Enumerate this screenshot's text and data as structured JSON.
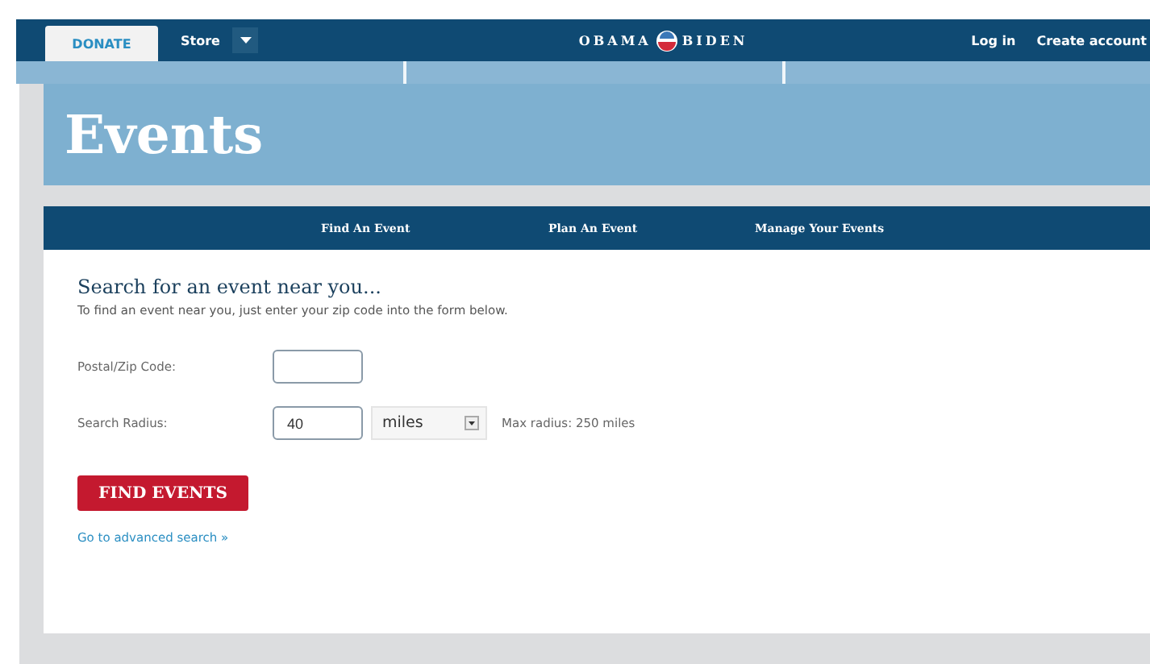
{
  "top_bar": {
    "donate": "DONATE",
    "store": "Store",
    "logo_left": "OBAMA",
    "logo_right": "BIDEN",
    "links": [
      "Log in",
      "Create account"
    ]
  },
  "banner": {
    "title": "Events"
  },
  "nav": [
    "Find An Event",
    "Plan An Event",
    "Manage Your Events"
  ],
  "search": {
    "heading": "Search for an event near you...",
    "intro": "To find an event near you, just enter your zip code into the form below.",
    "zip": {
      "label": "Postal/Zip Code:"
    },
    "radius": {
      "label": "Search Radius:",
      "value": "40",
      "unit": "miles",
      "note": "Max radius: 250 miles"
    },
    "submit": "FIND EVENTS",
    "advanced_link": "Go to advanced search »"
  }
}
